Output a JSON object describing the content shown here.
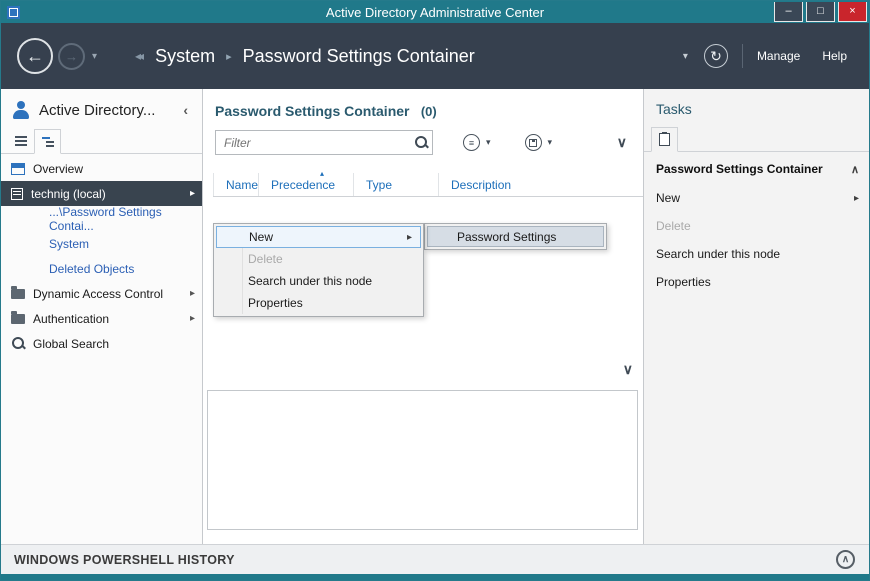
{
  "window": {
    "title": "Active Directory Administrative Center",
    "minimize_label": "–",
    "maximize_label": "□",
    "close_label": "×"
  },
  "nav": {
    "back_glyph": "←",
    "forward_glyph": "→",
    "history_caret": "▾",
    "breadcrumb_collapse": "◂◂",
    "breadcrumb": [
      "System",
      "Password Settings Container"
    ],
    "breadcrumb_separator": "▸",
    "scope_caret": "▾",
    "refresh_glyph": "↻",
    "manage_label": "Manage",
    "help_label": "Help"
  },
  "sidebar": {
    "title": "Active Directory...",
    "collapse_glyph": "‹",
    "items": [
      {
        "label": "Overview"
      },
      {
        "label": "technig (local)",
        "expand": "▸",
        "selected": true
      },
      {
        "label": "...\\Password Settings Contai..."
      },
      {
        "label": "System"
      },
      {
        "label": "Deleted Objects"
      },
      {
        "label": "Dynamic Access Control",
        "expand": "▸"
      },
      {
        "label": "Authentication",
        "expand": "▸"
      },
      {
        "label": "Global Search"
      }
    ]
  },
  "main": {
    "title": "Password Settings Container",
    "count": "(0)",
    "filter_placeholder": "Filter",
    "view_caret": "▾",
    "save_caret": "▾",
    "collapse_chevron": "∨",
    "sort_indicator": "▴",
    "columns": [
      "Name",
      "Precedence",
      "Type",
      "Description"
    ],
    "context_menu": {
      "items": [
        {
          "label": "New",
          "arrow": "▸",
          "highlighted": true
        },
        {
          "label": "Delete",
          "disabled": true
        },
        {
          "label": "Search under this node"
        },
        {
          "label": "Properties"
        }
      ],
      "submenu": [
        {
          "label": "Password Settings",
          "highlighted": true
        }
      ]
    },
    "preview_chevron": "∨"
  },
  "tasks": {
    "title": "Tasks",
    "section_title": "Password Settings Container",
    "section_chevron": "∧",
    "items": [
      {
        "label": "New",
        "arrow": "▸"
      },
      {
        "label": "Delete",
        "disabled": true
      },
      {
        "label": "Search under this node"
      },
      {
        "label": "Properties"
      }
    ]
  },
  "footer": {
    "label": "WINDOWS POWERSHELL HISTORY",
    "chevron": "∧"
  },
  "colors": {
    "titlebar_teal": "#20798a",
    "navbar_slate": "#36404e",
    "close_red": "#c9252c",
    "link_blue": "#2b5fb4",
    "column_blue": "#1d6fba",
    "header_teal": "#2a5a6e",
    "selected_row": "#39444f",
    "menu_highlight_border": "#7ab0e0"
  }
}
